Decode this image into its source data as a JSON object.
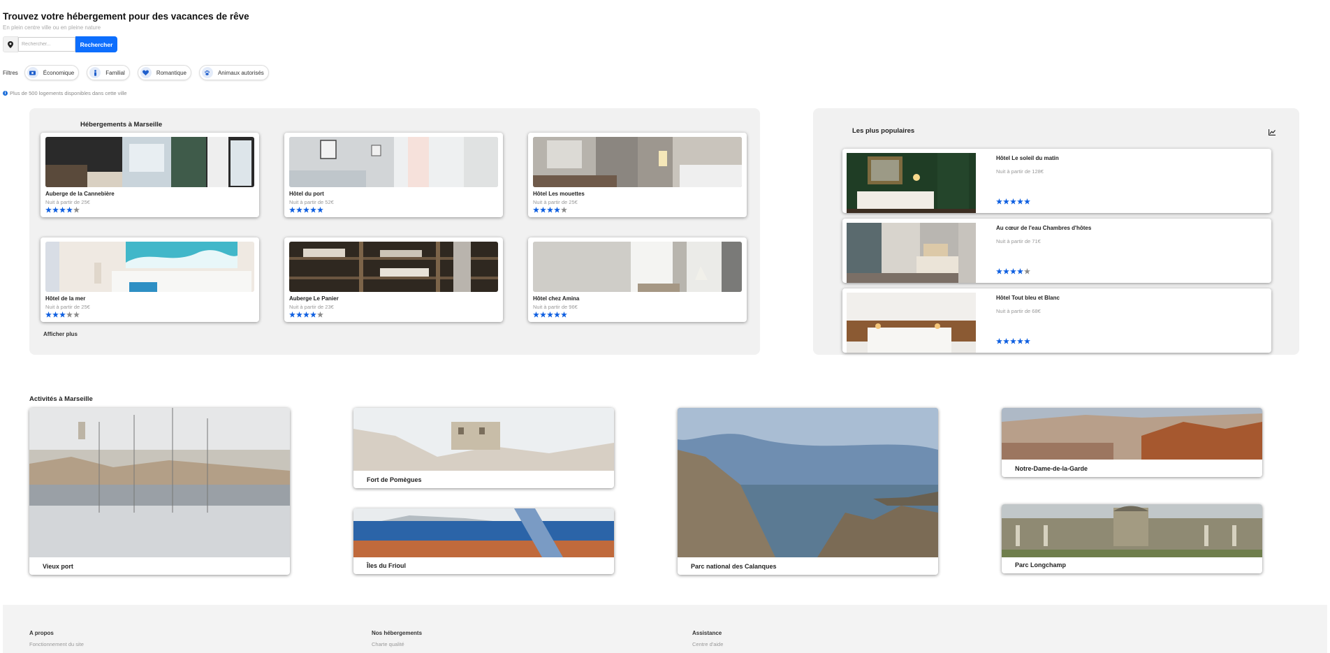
{
  "header": {
    "title": "Trouvez votre hébergement pour des vacances de rêve",
    "subtitle": "En plein centre ville ou en pleine nature"
  },
  "search": {
    "placeholder": "Rechercher...",
    "button_label": "Rechercher",
    "pin_icon": "map-pin-icon"
  },
  "filters": {
    "label": "Filtres",
    "items": [
      {
        "label": "Économique",
        "icon": "money-icon"
      },
      {
        "label": "Familial",
        "icon": "child-icon"
      },
      {
        "label": "Romantique",
        "icon": "heart-icon"
      },
      {
        "label": "Animaux autorisés",
        "icon": "paw-icon"
      }
    ]
  },
  "info": {
    "text": "Plus de 500 logements disponibles dans cette ville"
  },
  "accommodations": {
    "title": "Hébergements à Marseille",
    "show_more_label": "Afficher plus",
    "hotels": [
      {
        "name": "Auberge de la Cannebière",
        "price": "Nuit à partir de 25€",
        "rating": 4
      },
      {
        "name": "Hôtel du port",
        "price": "Nuit à partir de 52€",
        "rating": 5
      },
      {
        "name": "Hôtel Les mouettes",
        "price": "Nuit à partir de 25€",
        "rating": 4
      },
      {
        "name": "Hôtel de la mer",
        "price": "Nuit à partir de 25€",
        "rating": 3
      },
      {
        "name": "Auberge Le Panier",
        "price": "Nuit à partir de 23€",
        "rating": 4
      },
      {
        "name": "Hôtel chez Amina",
        "price": "Nuit à partir de 96€",
        "rating": 5
      }
    ]
  },
  "popular": {
    "title": "Les plus populaires",
    "icon": "chart-line-icon",
    "items": [
      {
        "name": "Hôtel Le soleil du matin",
        "price": "Nuit à partir de 128€",
        "rating": 5
      },
      {
        "name": "Au cœur de l'eau Chambres d'hôtes",
        "price": "Nuit à partir de 71€",
        "rating": 4
      },
      {
        "name": "Hôtel Tout bleu et Blanc",
        "price": "Nuit à partir de 68€",
        "rating": 5
      }
    ]
  },
  "activities": {
    "title": "Activités à Marseille",
    "items": [
      {
        "label": "Vieux port"
      },
      {
        "label": "Fort de Pomègues"
      },
      {
        "label": "Îles du Frioul"
      },
      {
        "label": "Parc national des Calanques"
      },
      {
        "label": "Notre-Dame-de-la-Garde"
      },
      {
        "label": "Parc Longchamp"
      }
    ]
  },
  "footer": {
    "columns": [
      {
        "heading": "A propos",
        "link": "Fonctionnement du site"
      },
      {
        "heading": "Nos hébergements",
        "link": "Charte qualité"
      },
      {
        "heading": "Assistance",
        "link": "Centre d'aide"
      }
    ]
  },
  "colors": {
    "accent": "#0d6efd",
    "star_filled": "#0d5ee0",
    "star_empty": "#8a8a8a",
    "panel_bg": "#f1f1f1"
  }
}
